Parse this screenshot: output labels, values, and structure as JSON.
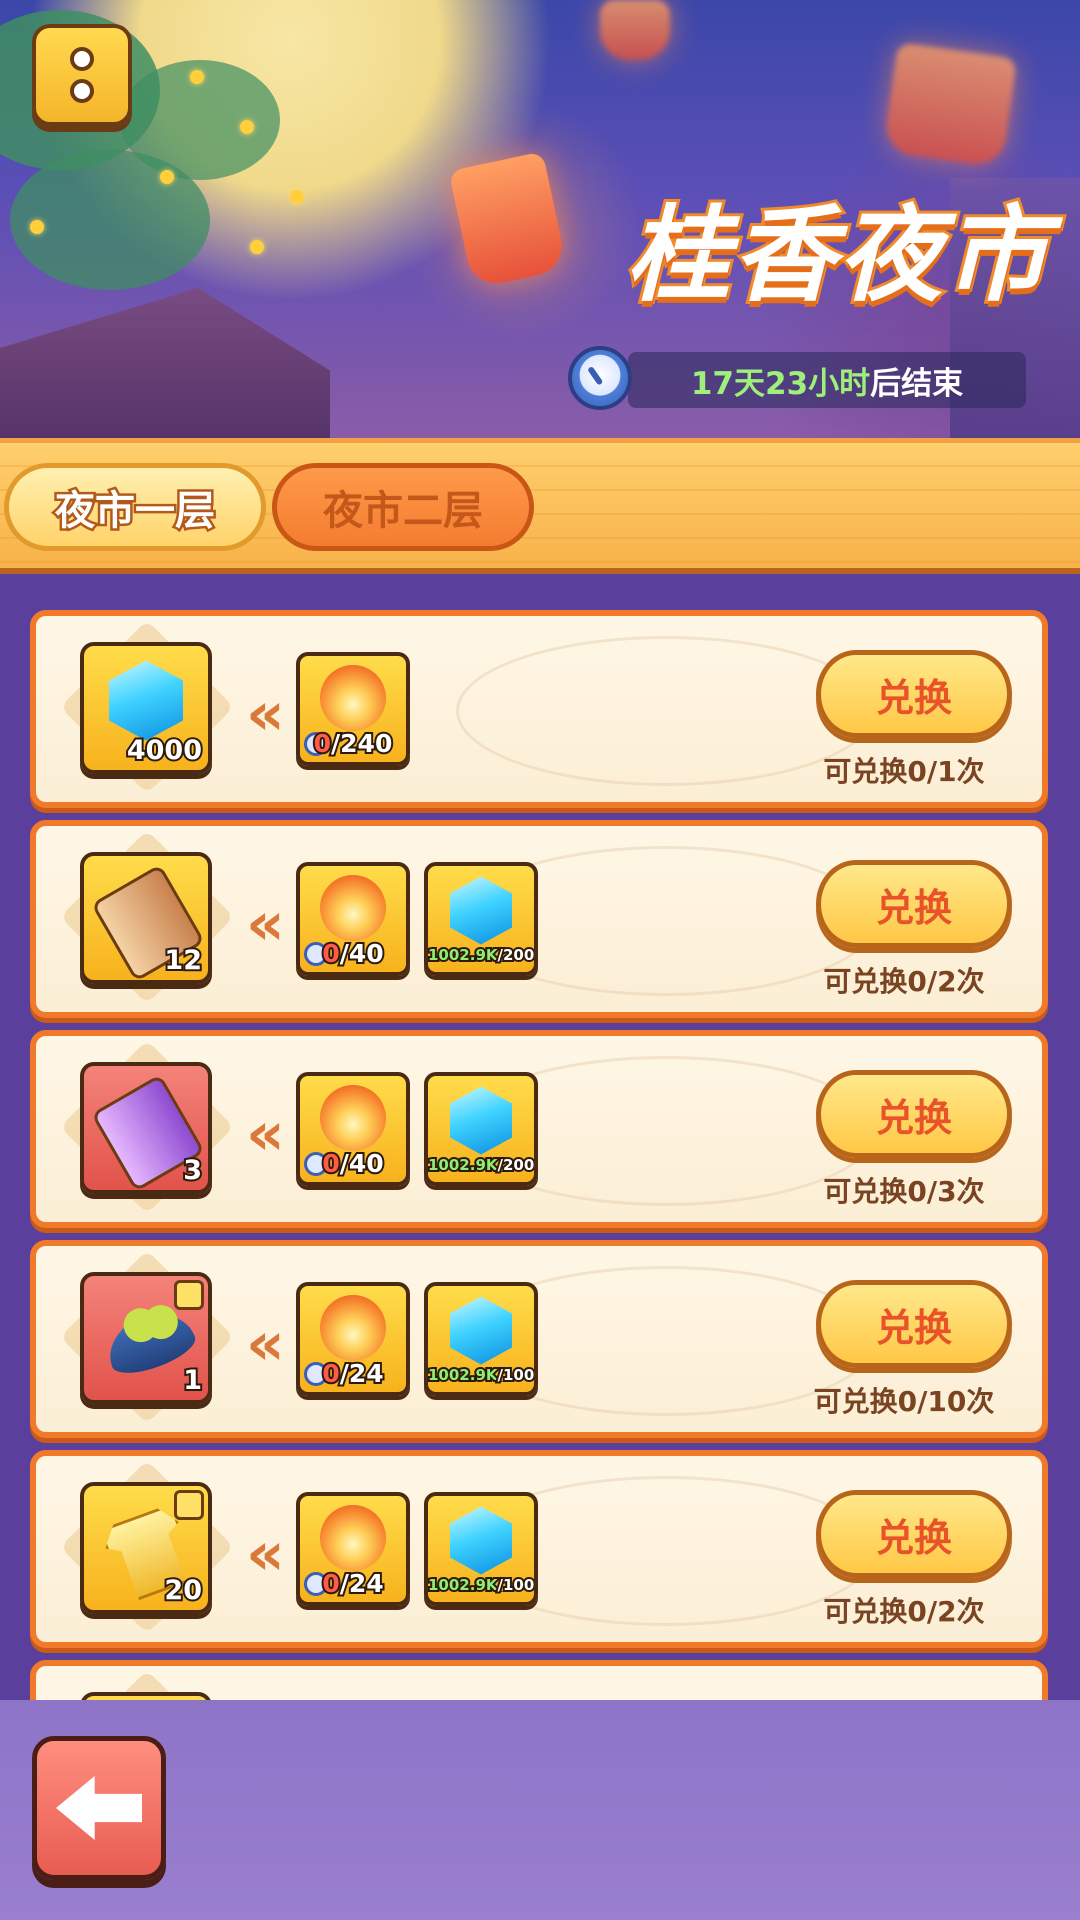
{
  "header": {
    "event_title": "桂香夜市",
    "timer_value": "17天23小时",
    "timer_suffix": "后结束",
    "icons": {
      "menu": "menu-icon",
      "clock": "clock-icon"
    }
  },
  "tabs": [
    {
      "label": "夜市一层",
      "active": true
    },
    {
      "label": "夜市二层",
      "active": false
    }
  ],
  "exchange_items": [
    {
      "reward": {
        "icon": "gem-icon",
        "quantity": "4000",
        "frame": "gold"
      },
      "costs": [
        {
          "icon": "lantern-icon",
          "have": "0",
          "need": "/240"
        }
      ],
      "button_label": "兑换",
      "limit_text": "可兑换0/1次"
    },
    {
      "reward": {
        "icon": "scroll-icon",
        "quantity": "12",
        "frame": "gold"
      },
      "costs": [
        {
          "icon": "lantern-icon",
          "have": "0",
          "need": "/40"
        },
        {
          "icon": "gem-icon",
          "have": "1002.9K",
          "need": "/200"
        }
      ],
      "button_label": "兑换",
      "limit_text": "可兑换0/2次"
    },
    {
      "reward": {
        "icon": "purple-scroll-icon",
        "quantity": "3",
        "frame": "red"
      },
      "costs": [
        {
          "icon": "lantern-icon",
          "have": "0",
          "need": "/40"
        },
        {
          "icon": "gem-icon",
          "have": "1002.9K",
          "need": "/200"
        }
      ],
      "button_label": "兑换",
      "limit_text": "可兑换0/3次"
    },
    {
      "reward": {
        "icon": "pea-pod-icon",
        "quantity": "1",
        "frame": "red"
      },
      "costs": [
        {
          "icon": "lantern-icon",
          "have": "0",
          "need": "/24"
        },
        {
          "icon": "gem-icon",
          "have": "1002.9K",
          "need": "/100"
        }
      ],
      "button_label": "兑换",
      "limit_text": "可兑换0/10次"
    },
    {
      "reward": {
        "icon": "golden-shirt-icon",
        "quantity": "20",
        "frame": "gold"
      },
      "costs": [
        {
          "icon": "lantern-icon",
          "have": "0",
          "need": "/24"
        },
        {
          "icon": "gem-icon",
          "have": "1002.9K",
          "need": "/100"
        }
      ],
      "button_label": "兑换",
      "limit_text": "可兑换0/2次"
    }
  ],
  "footer": {
    "back_icon": "back-arrow-icon"
  },
  "colors": {
    "accent_orange": "#f07a2a",
    "button_text": "#e8532a",
    "timer_green": "#9ef07a",
    "gem_amount_green": "#8df06f",
    "lacking_red": "#ff5a4a",
    "page_purple": "#5a3f9c"
  }
}
